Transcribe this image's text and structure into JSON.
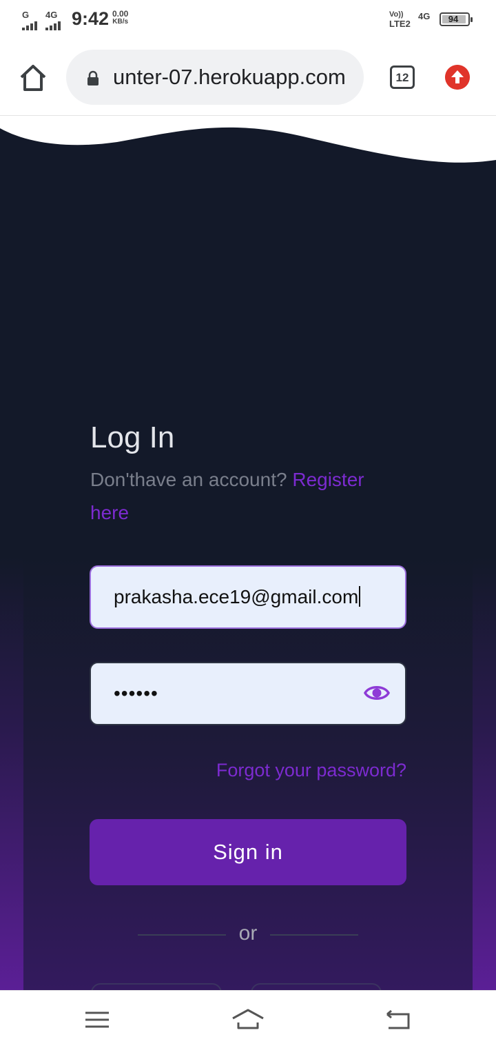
{
  "status_bar": {
    "signal1_label": "G",
    "signal2_label": "4G",
    "time": "9:42",
    "speed_value": "0.00",
    "speed_unit": "KB/s",
    "volte_label": "Vo))",
    "lte_label": "LTE2",
    "network_label": "4G",
    "battery_level": "94"
  },
  "browser": {
    "url": "unter-07.herokuapp.com",
    "tab_count": "12"
  },
  "login": {
    "title": "Log In",
    "no_account_text": "Don'thave an account? ",
    "register_link": "Register here",
    "email_value": "prakasha.ece19@gmail.com",
    "password_mask": "••••••",
    "forgot_link": "Forgot your password?",
    "signin_label": "Sign in",
    "divider_text": "or"
  },
  "colors": {
    "page_bg": "#131929",
    "accent": "#6622ac",
    "link": "#7c2bd0",
    "input_bg": "#e8effc"
  },
  "icons": {
    "home": "home-icon",
    "lock": "lock-icon",
    "tabs": "tabs-counter-icon",
    "update": "update-arrow-icon",
    "eye": "eye-icon",
    "menu": "menu-icon",
    "nav_home": "nav-home-icon",
    "back": "back-icon"
  }
}
